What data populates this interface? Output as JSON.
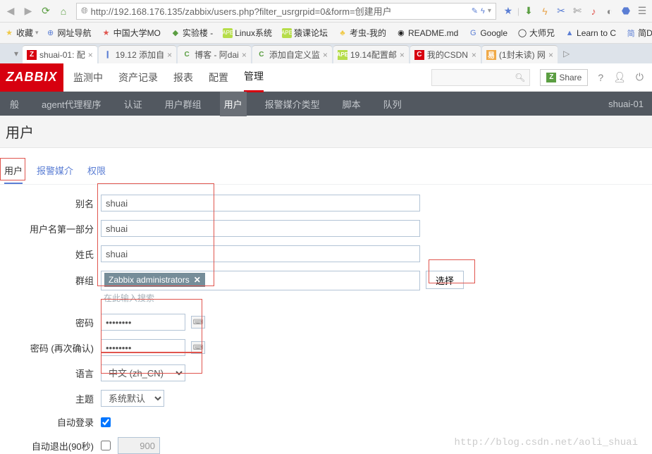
{
  "browser": {
    "url": "http://192.168.176.135/zabbix/users.php?filter_usrgrpid=0&form=创建用户",
    "bookmarks_label": "收藏",
    "bookmarks": [
      {
        "icon": "bi-blue",
        "glyph": "⊕",
        "label": "网址导航"
      },
      {
        "icon": "bi-red",
        "glyph": "★",
        "label": "中国大学MO"
      },
      {
        "icon": "bi-green",
        "glyph": "◆",
        "label": "实验楼 -"
      },
      {
        "icon": "bi-lime",
        "glyph": "APE",
        "label": "Linux系统"
      },
      {
        "icon": "bi-lime",
        "glyph": "APE",
        "label": "猿课论坛"
      },
      {
        "icon": "bi-yellow",
        "glyph": "♣",
        "label": "考虫-我的"
      },
      {
        "icon": "bi-black",
        "glyph": "◉",
        "label": "README.md"
      },
      {
        "icon": "bi-blue",
        "glyph": "G",
        "label": "Google"
      },
      {
        "icon": "bi-black",
        "glyph": "◯",
        "label": "大师兄"
      },
      {
        "icon": "bi-blue",
        "glyph": "▲",
        "label": "Learn to C"
      },
      {
        "icon": "bi-blue",
        "glyph": "简",
        "label": "简Dj"
      }
    ],
    "tabs": [
      {
        "fav": "fv-z",
        "glyph": "Z",
        "label": "shuai-01: 配",
        "active": true
      },
      {
        "fav": "fv-blue",
        "glyph": "❙",
        "label": "19.12 添加自"
      },
      {
        "fav": "fv-green",
        "glyph": "C",
        "label": "博客 - 阿dai"
      },
      {
        "fav": "fv-green",
        "glyph": "C",
        "label": "添加自定义监"
      },
      {
        "fav": "fv-lime",
        "glyph": "APE",
        "label": "19.14配置邮"
      },
      {
        "fav": "fv-red",
        "glyph": "C",
        "label": "我的CSDN"
      },
      {
        "fav": "fv-orange",
        "glyph": "易",
        "label": "(1封未读) 网"
      }
    ]
  },
  "zabbix": {
    "logo": "ZABBIX",
    "topnav": [
      "监测中",
      "资产记录",
      "报表",
      "配置",
      "管理"
    ],
    "topnav_active": 4,
    "share": "Share",
    "subnav": [
      "般",
      "agent代理程序",
      "认证",
      "用户群组",
      "用户",
      "报警媒介类型",
      "脚本",
      "队列"
    ],
    "subnav_active": 4,
    "subnav_user": "shuai-01",
    "page_title": "用户",
    "form_tabs": [
      "用户",
      "报警媒介",
      "权限"
    ],
    "form_tab_active": 0
  },
  "form": {
    "alias_label": "别名",
    "alias_value": "shuai",
    "name_label": "用户名第一部分",
    "name_value": "shuai",
    "surname_label": "姓氏",
    "surname_value": "shuai",
    "group_label": "群组",
    "group_chip": "Zabbix administrators",
    "group_hint": "在此输入搜索",
    "group_select_btn": "选择",
    "password_label": "密码",
    "password_value": "••••••••",
    "password2_label": "密码 (再次确认)",
    "password2_value": "••••••••",
    "lang_label": "语言",
    "lang_value": "中文 (zh_CN)",
    "theme_label": "主题",
    "theme_value": "系统默认",
    "autologin_label": "自动登录",
    "autologout_label": "自动退出(90秒)",
    "autologout_value": "900"
  },
  "watermark": "http://blog.csdn.net/aoli_shuai"
}
